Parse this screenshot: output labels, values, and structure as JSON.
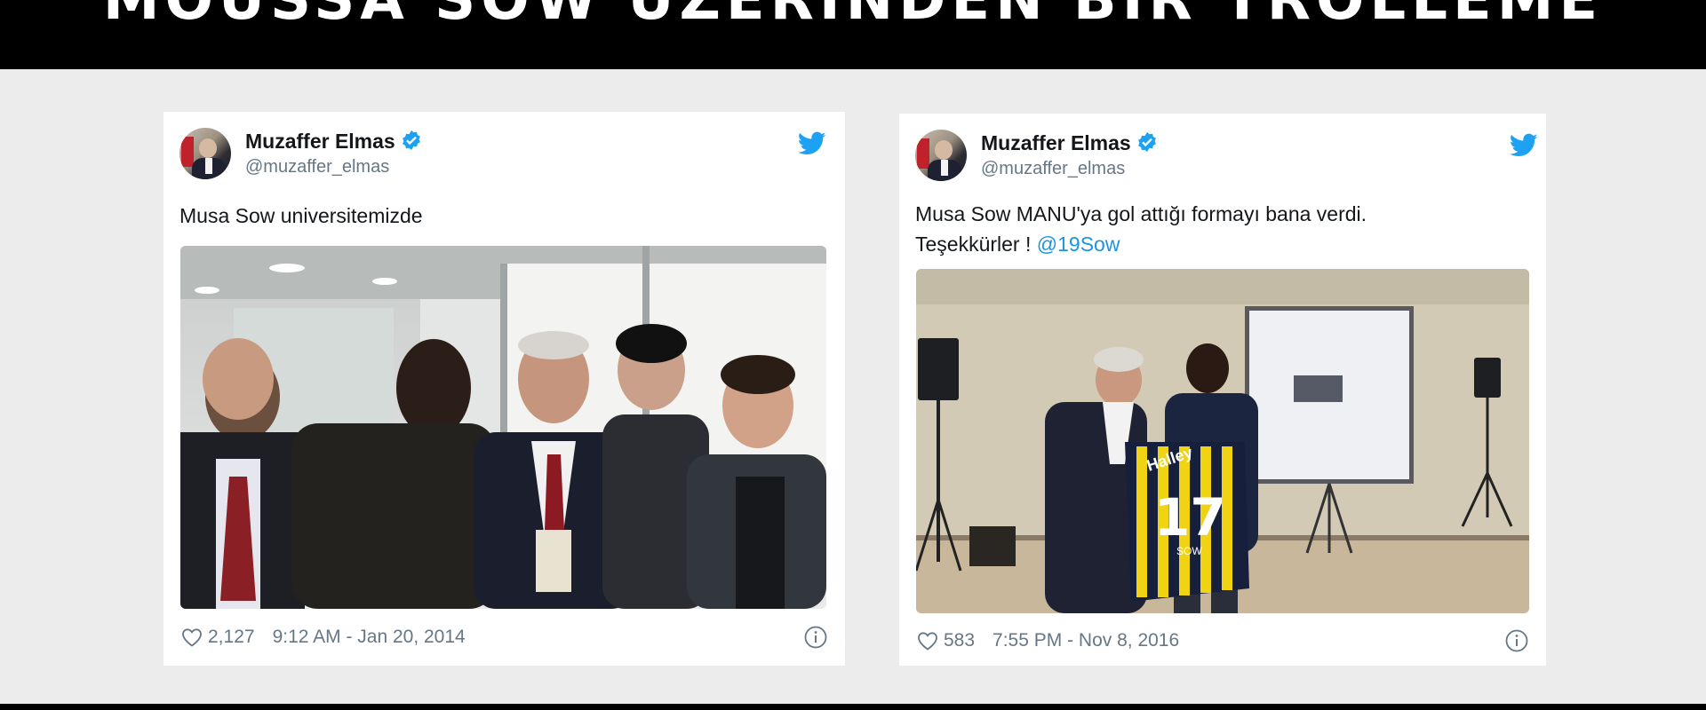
{
  "banner": {
    "title": "MOUSSA SOW ÜZERİNDEN BİR TROLLEME"
  },
  "tweets": [
    {
      "author_name": "Muzaffer Elmas",
      "handle": "@muzaffer_elmas",
      "text_line1": "Musa Sow universitemizde",
      "likes": "2,127",
      "timestamp": "9:12 AM - Jan 20, 2014",
      "photo_caption": ""
    },
    {
      "author_name": "Muzaffer Elmas",
      "handle": "@muzaffer_elmas",
      "text_line1": "Musa Sow MANU'ya gol attığı formayı bana verdi.",
      "text_line2": "Teşekkürler ! ",
      "mention": "@19Sow",
      "likes": "583",
      "timestamp": "7:55 PM - Nov 8, 2016",
      "jersey_sponsor": "Halley",
      "jersey_number": "17",
      "jersey_name": "SOW"
    }
  ],
  "colors": {
    "twitter_blue": "#1da1f2",
    "mention": "#1b95e0",
    "meta_gray": "#657786"
  }
}
